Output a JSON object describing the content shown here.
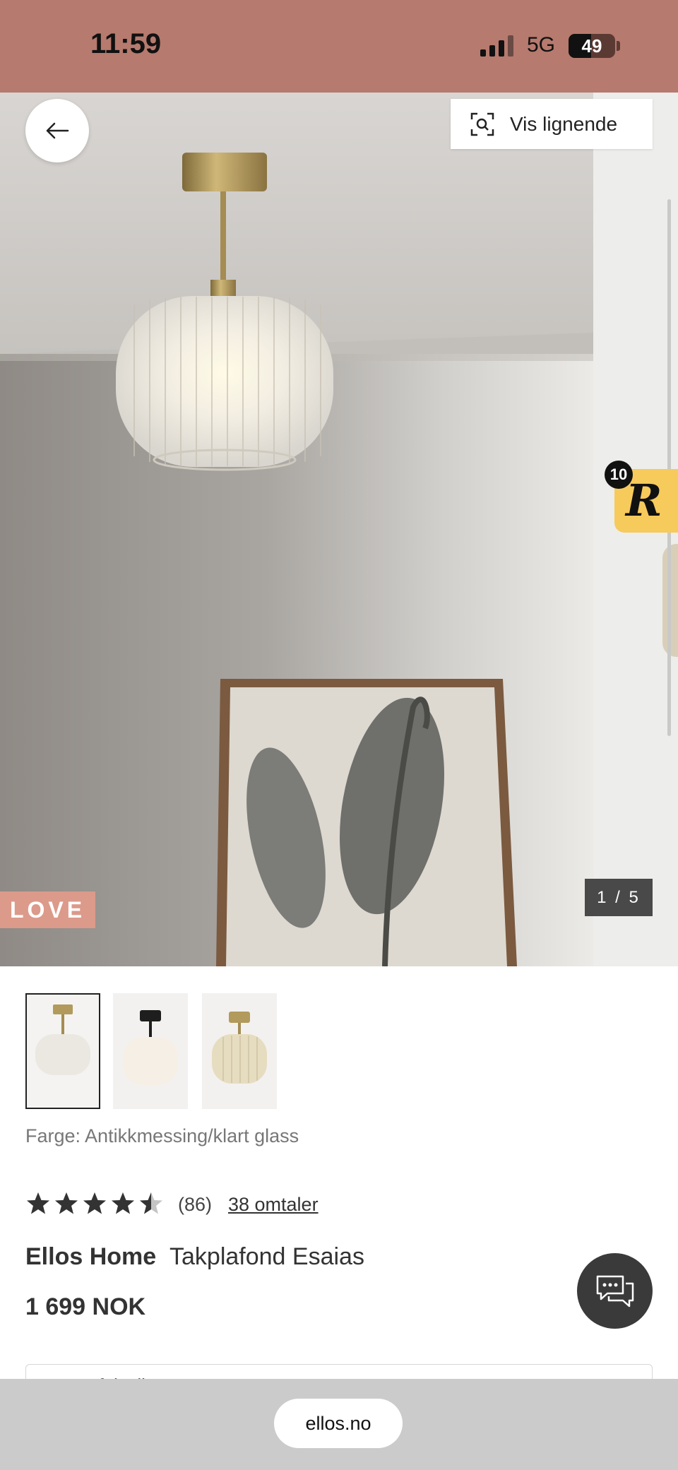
{
  "status_bar": {
    "time": "11:59",
    "network": "5G",
    "battery": "49",
    "battery_level": 0.49
  },
  "top_actions": {
    "similar_label": "Vis lignende"
  },
  "hero": {
    "badge": "LOVE",
    "counter": "1 / 5",
    "widget_count": "10",
    "widget_letter": "R"
  },
  "product": {
    "color_label": "Farge: Antikkmessing/klart glass",
    "rating_value": 4.5,
    "rating_count": "(86)",
    "reviews_link": "38 omtaler",
    "brand": "Ellos Home",
    "name": "Takplafond Esaias",
    "price": "1 699 NOK",
    "info_text": "Bestefaktylle pa"
  },
  "browser": {
    "url": "ellos.no"
  },
  "colors": {
    "status_bar_bg": "#b67a6e",
    "love_badge": "#dc9a8a",
    "widget_bg": "#f7ca5c",
    "chat_bg": "#3a3a3a"
  },
  "icons": [
    "back-arrow-icon",
    "visual-search-icon",
    "star-icon",
    "chat-icon",
    "signal-icon",
    "battery-icon"
  ]
}
